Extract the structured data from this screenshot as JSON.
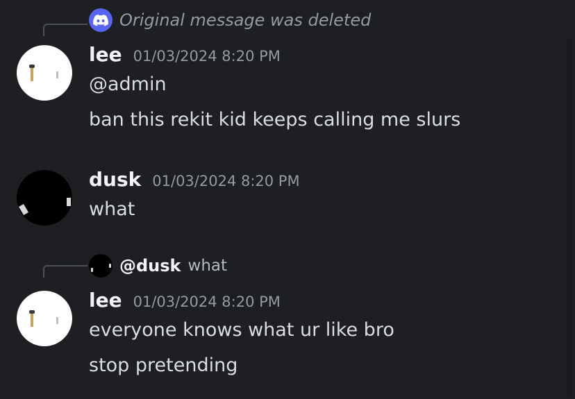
{
  "messages": [
    {
      "reply": {
        "type": "deleted",
        "text": "Original message was deleted"
      },
      "author": "lee",
      "timestamp": "01/03/2024 8:20 PM",
      "avatar": "white-avatar-with-figures",
      "lines": [
        "@admin",
        "ban this rekit kid keeps calling me slurs"
      ]
    },
    {
      "author": "dusk",
      "timestamp": "01/03/2024 8:20 PM",
      "avatar": "black-avatar",
      "lines": [
        "what"
      ]
    },
    {
      "reply": {
        "type": "reply",
        "author": "@dusk",
        "text": "what"
      },
      "author": "lee",
      "timestamp": "01/03/2024 8:20 PM",
      "avatar": "white-avatar-with-figures",
      "lines": [
        "everyone knows what ur like bro",
        "stop pretending"
      ]
    }
  ],
  "colors": {
    "background": "#1e1f22",
    "username": "#f2f3f5",
    "timestamp": "#949ba4",
    "message_text": "#dbdee1",
    "discord_blurple": "#5865f2"
  },
  "icons": [
    "discord-logo-icon"
  ]
}
